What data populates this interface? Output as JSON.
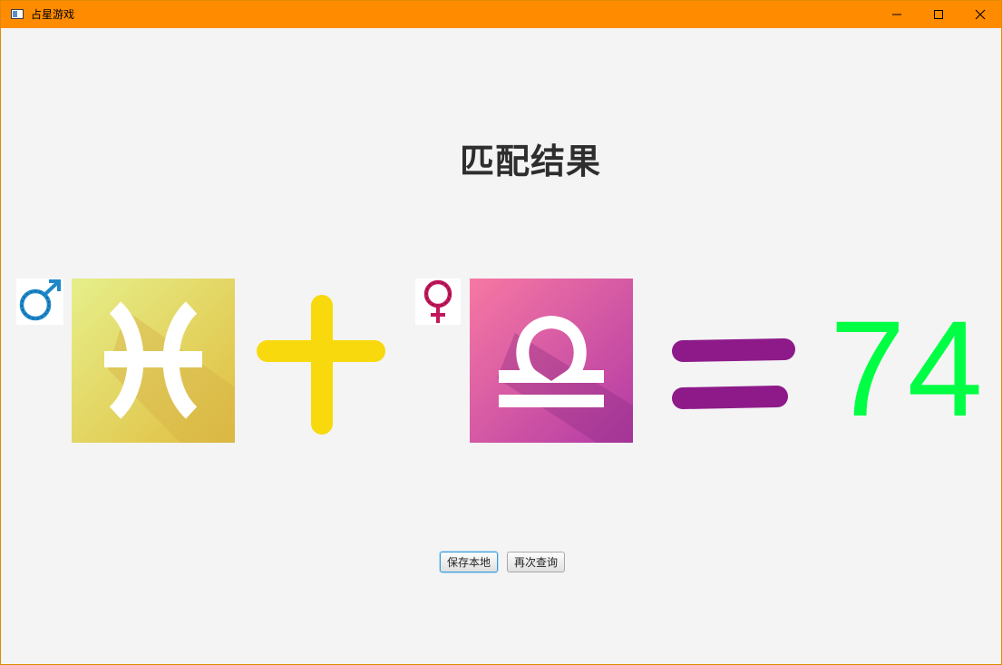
{
  "window": {
    "title": "占星游戏",
    "titlebar_color": "#ff8c00"
  },
  "main": {
    "heading": "匹配结果",
    "male": {
      "symbol": "male-symbol-icon",
      "sign": "pisces",
      "sign_colors": [
        "#e6ef8a",
        "#e0bd3e"
      ]
    },
    "plus_icon": "plus-icon",
    "female": {
      "symbol": "female-symbol-icon",
      "sign": "libra",
      "sign_colors": [
        "#f778a3",
        "#b23aa5"
      ]
    },
    "equals_icon": "equals-icon",
    "score": "74",
    "score_color": "#00ff44"
  },
  "buttons": {
    "save_label": "保存本地",
    "again_label": "再次查询"
  }
}
